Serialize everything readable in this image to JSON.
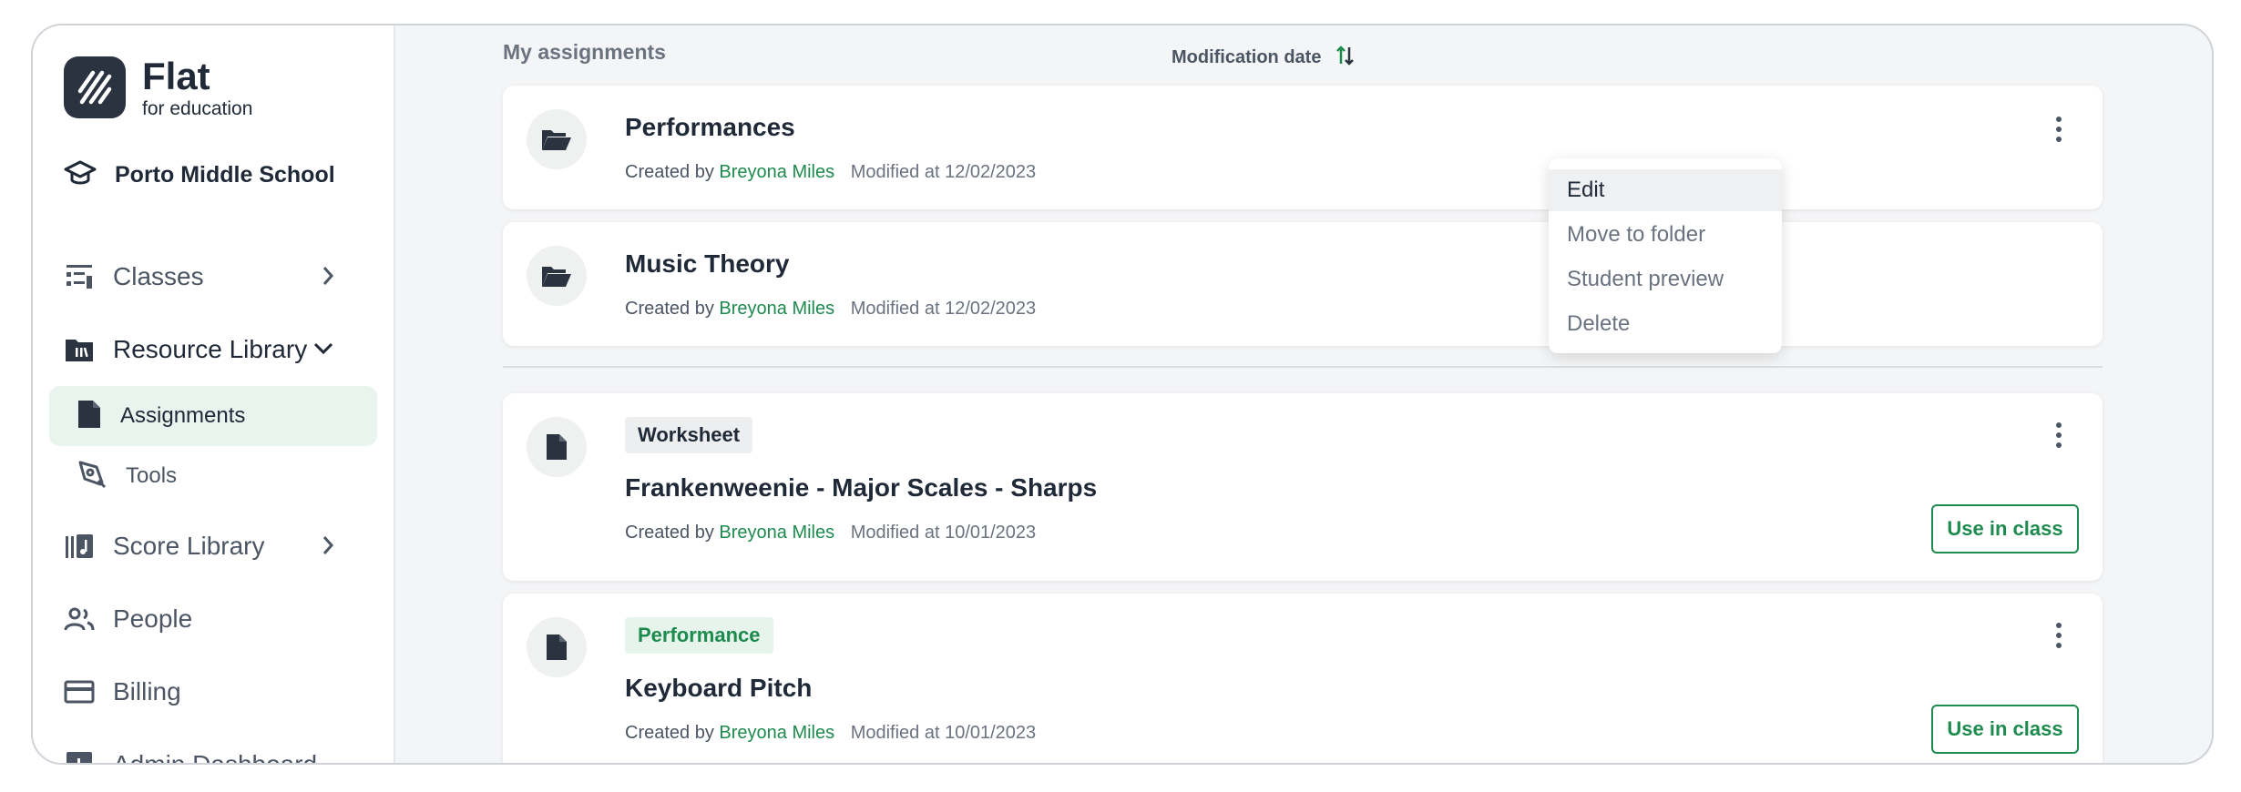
{
  "brand": {
    "title": "Flat",
    "subtitle": "for education"
  },
  "school": {
    "name": "Porto Middle School"
  },
  "sidebar": {
    "items": [
      {
        "label": "Classes"
      },
      {
        "label": "Resource Library"
      },
      {
        "label": "Assignments"
      },
      {
        "label": "Tools"
      },
      {
        "label": "Score Library"
      },
      {
        "label": "People"
      },
      {
        "label": "Billing"
      },
      {
        "label": "Admin Dashboard"
      }
    ]
  },
  "main": {
    "section_title": "My assignments",
    "sort_label": "Modification date",
    "cards": [
      {
        "title": "Performances",
        "created_by": "Created by",
        "author": "Breyona Miles",
        "modified": "Modified at 12/02/2023"
      },
      {
        "title": "Music Theory",
        "created_by": "Created by",
        "author": "Breyona Miles",
        "modified": "Modified at 12/02/2023"
      },
      {
        "tag": "Worksheet",
        "title": "Frankenweenie - Major Scales - Sharps",
        "created_by": "Created by",
        "author": "Breyona Miles",
        "modified": "Modified at 10/01/2023",
        "action": "Use in class"
      },
      {
        "tag": "Performance",
        "title": "Keyboard Pitch",
        "created_by": "Created by",
        "author": "Breyona Miles",
        "modified": "Modified at 10/01/2023",
        "action": "Use in class"
      }
    ]
  },
  "context_menu": {
    "items": [
      "Edit",
      "Move to folder",
      "Student preview",
      "Delete"
    ]
  },
  "colors": {
    "accent": "#1d8a4e",
    "active_bg": "#e9f4ee",
    "dark": "#2c3340"
  }
}
